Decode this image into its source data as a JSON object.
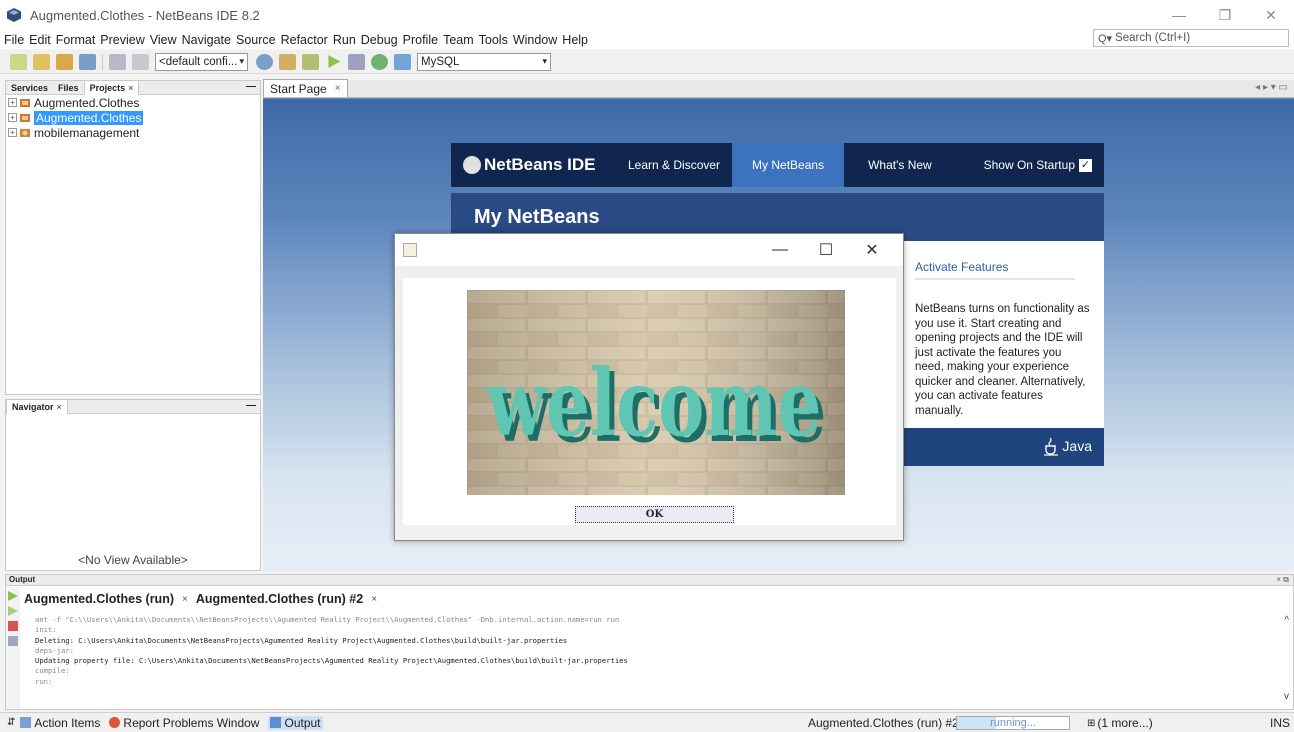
{
  "window": {
    "title": "Augmented.Clothes - NetBeans IDE 8.2",
    "minimize": "—",
    "restore": "❐",
    "close": "✕"
  },
  "menu": [
    "File",
    "Edit",
    "Format",
    "Preview",
    "View",
    "Navigate",
    "Source",
    "Refactor",
    "Run",
    "Debug",
    "Profile",
    "Team",
    "Tools",
    "Window",
    "Help"
  ],
  "search": {
    "label": "Search (Ctrl+I)"
  },
  "toolbar": {
    "config": "<default confi...",
    "database": "MySQL"
  },
  "projects_panel": {
    "tabs": [
      "Services",
      "Files",
      "Projects"
    ],
    "active_tab_close": "×",
    "minimize": "—",
    "items": [
      {
        "label": "Augmented.Clothes",
        "toggle": "+"
      },
      {
        "label": "Augmented.Clothes",
        "toggle": "+"
      },
      {
        "label": "mobilemanagement",
        "toggle": "+"
      }
    ]
  },
  "navigator_panel": {
    "title": "Navigator",
    "close": "×",
    "minimize": "—",
    "empty": "<No View Available>"
  },
  "editor": {
    "tab": "Start Page",
    "close": "×",
    "controls": "◂ ▸ ▾ ▭"
  },
  "start_page": {
    "logo": "NetBeans IDE",
    "nav": [
      "Learn & Discover",
      "My NetBeans",
      "What's New"
    ],
    "show_on_startup": "Show On Startup",
    "check": "✓",
    "banner": "My NetBeans",
    "features_title": "Activate Features",
    "features_text": "NetBeans turns on functionality as you use it. Start creating and opening projects and the IDE will just activate the features you need, making your experience quicker and cleaner. Alternatively, you can activate features manually.",
    "java": "Java"
  },
  "dialog": {
    "minimize": "—",
    "maximize": "☐",
    "close": "✕",
    "image_text": "welcome",
    "ok": "OK"
  },
  "output": {
    "title": "Output",
    "controls": "× ⧉",
    "tabs": [
      {
        "label": "Augmented.Clothes (run)"
      },
      {
        "label": "Augmented.Clothes (run) #2"
      }
    ],
    "tab_close": "×",
    "lines": [
      {
        "text": "ant -f \"C:\\\\Users\\\\Ankita\\\\Documents\\\\NetBeansProjects\\\\Agumented Reality Project\\\\Augmented.Clothes\" -Dnb.internal.action.name=run run",
        "dim": true
      },
      {
        "text": "init:",
        "dim": true
      },
      {
        "text": "Deleting: C:\\Users\\Ankita\\Documents\\NetBeansProjects\\Agumented Reality Project\\Augmented.Clothes\\build\\built-jar.properties",
        "dim": false
      },
      {
        "text": "deps-jar:",
        "dim": true
      },
      {
        "text": "Updating property file: C:\\Users\\Ankita\\Documents\\NetBeansProjects\\Agumented Reality Project\\Augmented.Clothes\\build\\built-jar.properties",
        "dim": false
      },
      {
        "text": "compile:",
        "dim": true
      },
      {
        "text": "run:",
        "dim": true
      }
    ],
    "scroll_up": "^",
    "scroll_down": "v"
  },
  "statusbar": {
    "action_items": "Action Items",
    "report_problems": "Report Problems Window",
    "output": "Output",
    "task": "Augmented.Clothes (run) #2",
    "progress_text": "running...",
    "progress_fraction": 0.35,
    "more": "(1 more...)",
    "mode": "INS"
  }
}
